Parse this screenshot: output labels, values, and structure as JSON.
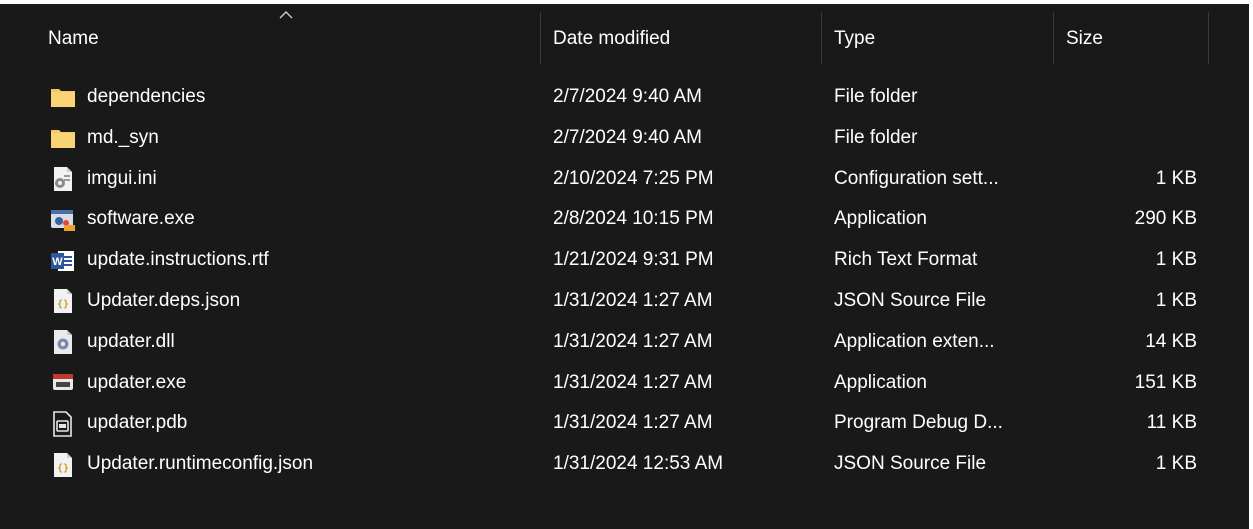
{
  "columns": {
    "name": "Name",
    "date": "Date modified",
    "type": "Type",
    "size": "Size",
    "sorted_by": "name",
    "sort_direction": "ascending"
  },
  "colors": {
    "background": "#191919",
    "text": "#ffffff",
    "folder": "#f5c860",
    "separator": "#3a3a3a"
  },
  "files": [
    {
      "icon": "folder-icon",
      "name": "dependencies",
      "date": "2/7/2024 9:40 AM",
      "type": "File folder",
      "size": ""
    },
    {
      "icon": "folder-icon",
      "name": "md._syn",
      "date": "2/7/2024 9:40 AM",
      "type": "File folder",
      "size": ""
    },
    {
      "icon": "settings-file-icon",
      "name": "imgui.ini",
      "date": "2/10/2024 7:25 PM",
      "type": "Configuration sett...",
      "size": "1 KB"
    },
    {
      "icon": "application-icon",
      "name": "software.exe",
      "date": "2/8/2024 10:15 PM",
      "type": "Application",
      "size": "290 KB"
    },
    {
      "icon": "word-document-icon",
      "name": "update.instructions.rtf",
      "date": "1/21/2024 9:31 PM",
      "type": "Rich Text Format",
      "size": "1 KB"
    },
    {
      "icon": "json-file-icon",
      "name": "Updater.deps.json",
      "date": "1/31/2024 1:27 AM",
      "type": "JSON Source File",
      "size": "1 KB"
    },
    {
      "icon": "dll-file-icon",
      "name": "updater.dll",
      "date": "1/31/2024 1:27 AM",
      "type": "Application exten...",
      "size": "14 KB"
    },
    {
      "icon": "updater-app-icon",
      "name": "updater.exe",
      "date": "1/31/2024 1:27 AM",
      "type": "Application",
      "size": "151 KB"
    },
    {
      "icon": "pdb-file-icon",
      "name": "updater.pdb",
      "date": "1/31/2024 1:27 AM",
      "type": "Program Debug D...",
      "size": "11 KB"
    },
    {
      "icon": "json-file-icon",
      "name": "Updater.runtimeconfig.json",
      "date": "1/31/2024 12:53 AM",
      "type": "JSON Source File",
      "size": "1 KB"
    }
  ]
}
